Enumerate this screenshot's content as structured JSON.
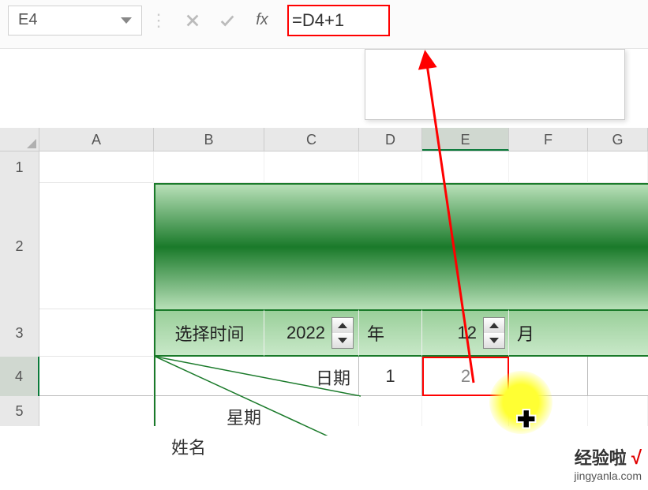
{
  "formula_bar": {
    "cell_ref": "E4",
    "formula": "=D4+1",
    "fx_label": "fx"
  },
  "columns": [
    "A",
    "B",
    "C",
    "D",
    "E",
    "F",
    "G"
  ],
  "rows": [
    "1",
    "2",
    "3",
    "4",
    "5"
  ],
  "selected_col": "E",
  "selected_row": "4",
  "row3": {
    "label": "选择时间",
    "year": "2022",
    "year_unit": "年",
    "month": "12",
    "month_unit": "月"
  },
  "row4": {
    "date_label": "日期",
    "week_label": "星期",
    "name_label": "姓名",
    "d4": "1",
    "e4": "2"
  },
  "watermark": {
    "line1": "经验啦",
    "check": "√",
    "line2": "jingyanla.com"
  }
}
